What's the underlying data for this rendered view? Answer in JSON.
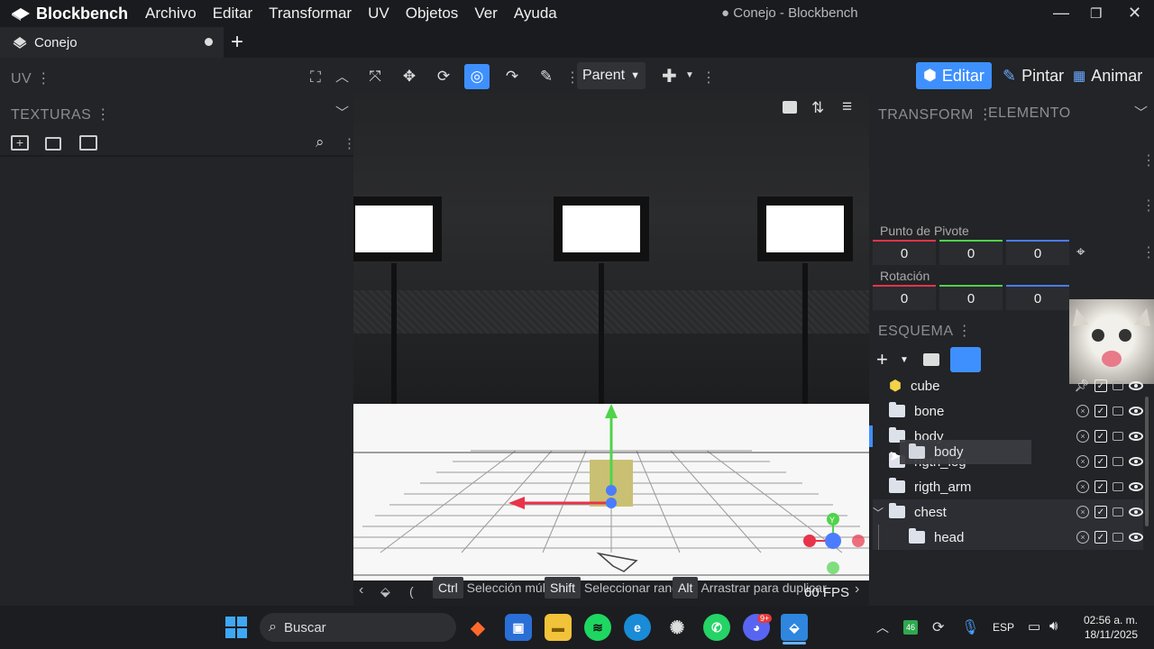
{
  "app": {
    "name": "Blockbench",
    "window_title": "Conejo - Blockbench"
  },
  "menu": [
    "Archivo",
    "Editar",
    "Transformar",
    "UV",
    "Objetos",
    "Ver",
    "Ayuda"
  ],
  "tab": {
    "label": "Conejo"
  },
  "left_panel": {
    "uv_title": "UV",
    "textures_title": "TEXTURAS"
  },
  "toolbar": {
    "parent_label": "Parent"
  },
  "modes": {
    "edit": "Editar",
    "paint": "Pintar",
    "animate": "Animar"
  },
  "right_panel": {
    "transform_title": "TRANSFORM",
    "element_title": "ELEMENTO",
    "pivot_label": "Punto de Pivote",
    "pivot": [
      "0",
      "0",
      "0"
    ],
    "rotation_label": "Rotación",
    "rotation": [
      "0",
      "0",
      "0"
    ],
    "outliner_title": "ESQUEMA"
  },
  "outliner": {
    "items": [
      {
        "label": "cube",
        "type": "cube"
      },
      {
        "label": "bone",
        "type": "folder"
      },
      {
        "label": "body",
        "type": "folder"
      },
      {
        "label": "rigth_leg",
        "type": "folder"
      },
      {
        "label": "rigth_arm",
        "type": "folder"
      },
      {
        "label": "chest",
        "type": "folder"
      },
      {
        "label": "head",
        "type": "folder"
      }
    ],
    "drag_tooltip": "body"
  },
  "statusbar": {
    "ctrl_key": "Ctrl",
    "ctrl_action": "Selección múltiple",
    "shift_key": "Shift",
    "shift_action": "Seleccionar rango",
    "alt_key": "Alt",
    "alt_action": "Arrastrar para duplicar",
    "fps": "60 FPS"
  },
  "taskbar": {
    "search_placeholder": "Buscar",
    "lang": "ESP",
    "time": "02:56 a. m.",
    "date": "18/11/2025",
    "discord_badge": "9+"
  },
  "colors": {
    "accent": "#3e90ff",
    "x_axis": "#e8344a",
    "y_axis": "#4fd34a",
    "z_axis": "#4a7cff"
  }
}
